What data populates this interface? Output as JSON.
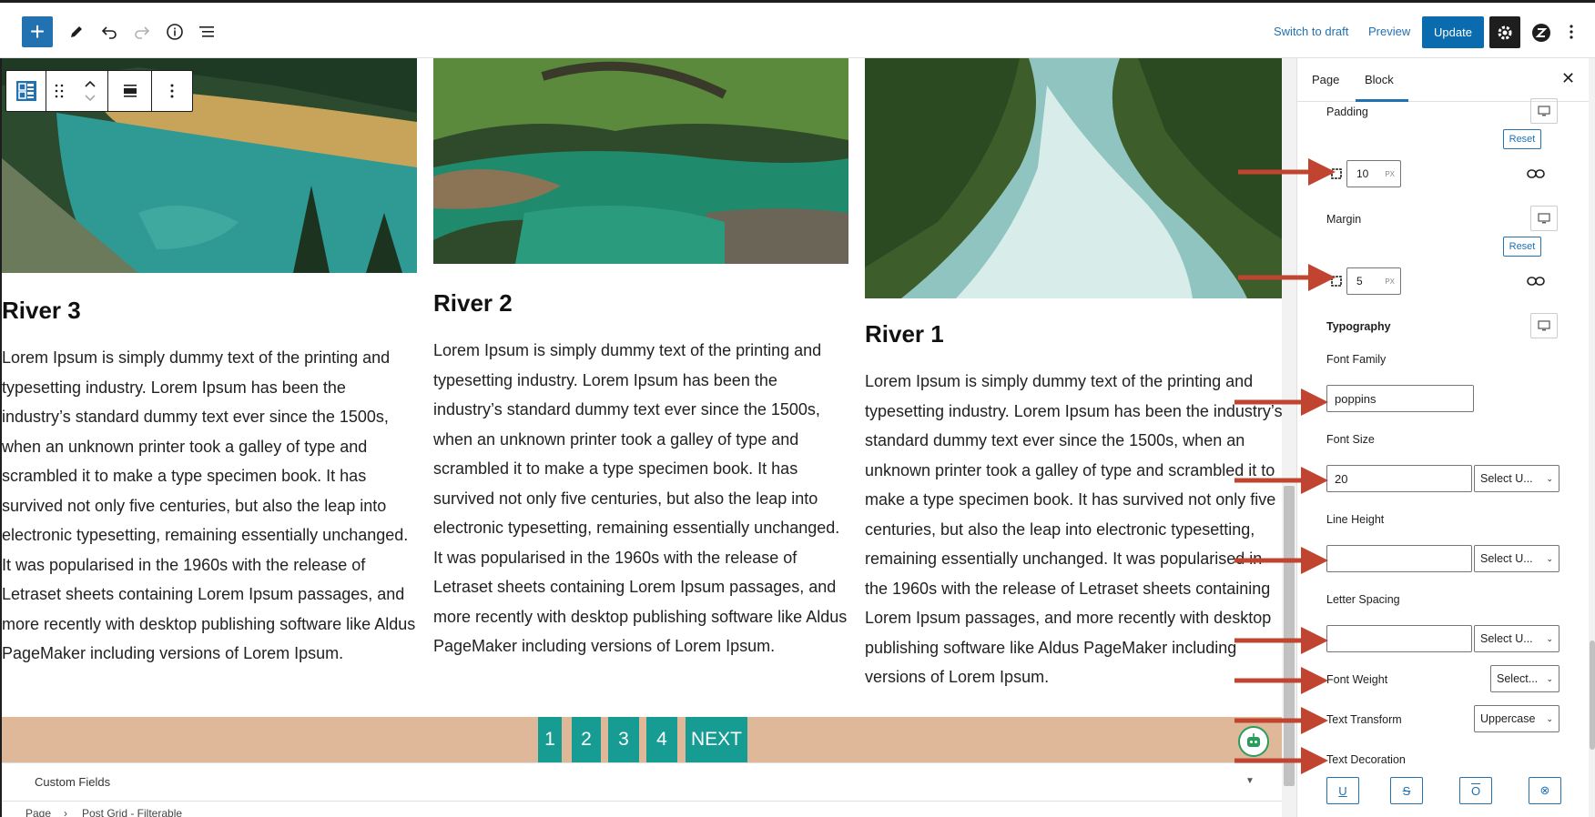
{
  "toolbar": {
    "switch_to_draft": "Switch to draft",
    "preview": "Preview",
    "update": "Update"
  },
  "posts": [
    {
      "title": "River 3",
      "body": "Lorem Ipsum is simply dummy text of the printing and typesetting industry. Lorem Ipsum has been the industry’s standard dummy text ever since the 1500s, when an unknown printer took a galley of type and scrambled it to make a type specimen book. It has survived not only five centuries, but also the leap into electronic typesetting, remaining essentially unchanged. It was popularised in the 1960s with the release of Letraset sheets containing Lorem Ipsum passages, and more recently with desktop publishing software like Aldus PageMaker including versions of Lorem Ipsum."
    },
    {
      "title": "River 2",
      "body": "Lorem Ipsum is simply dummy text of the printing and typesetting industry. Lorem Ipsum has been the industry’s standard dummy text ever since the 1500s, when an unknown printer took a galley of type and scrambled it to make a type specimen book. It has survived not only five centuries, but also the leap into electronic typesetting, remaining essentially unchanged. It was popularised in the 1960s with the release of Letraset sheets containing Lorem Ipsum passages, and more recently with desktop publishing software like Aldus PageMaker including versions of Lorem Ipsum."
    },
    {
      "title": "River 1",
      "body": "Lorem Ipsum is simply dummy text of the printing and typesetting industry. Lorem Ipsum has been the industry’s standard dummy text ever since the 1500s, when an unknown printer took a galley of type and scrambled it to make a type specimen book. It has survived not only five centuries, but also the leap into electronic typesetting, remaining essentially unchanged. It was popularised in the 1960s with the release of Letraset sheets containing Lorem Ipsum passages, and more recently with desktop publishing software like Aldus PageMaker including versions of Lorem Ipsum."
    }
  ],
  "pagination": [
    "1",
    "2",
    "3",
    "4",
    "NEXT"
  ],
  "custom_fields": "Custom Fields",
  "breadcrumb": {
    "page": "Page",
    "sep": "›",
    "block": "Post Grid - Filterable"
  },
  "sidebar": {
    "tab_page": "Page",
    "tab_block": "Block",
    "padding_label": "Padding",
    "padding_value": "10",
    "margin_label": "Margin",
    "margin_value": "5",
    "unit": "PX",
    "reset": "Reset",
    "typography_label": "Typography",
    "font_family_label": "Font Family",
    "font_family_value": "poppins",
    "font_size_label": "Font Size",
    "font_size_value": "20",
    "select_unit": "Select U...",
    "line_height_label": "Line Height",
    "letter_spacing_label": "Letter Spacing",
    "font_weight_label": "Font Weight",
    "font_weight_value": "Select...",
    "text_transform_label": "Text Transform",
    "text_transform_value": "Uppercase",
    "text_decoration_label": "Text Decoration"
  },
  "colors": {
    "accent": "#2271b1",
    "pager_bg": "#dfb899",
    "pager_item": "#179c94",
    "arrow": "#c0442f"
  }
}
